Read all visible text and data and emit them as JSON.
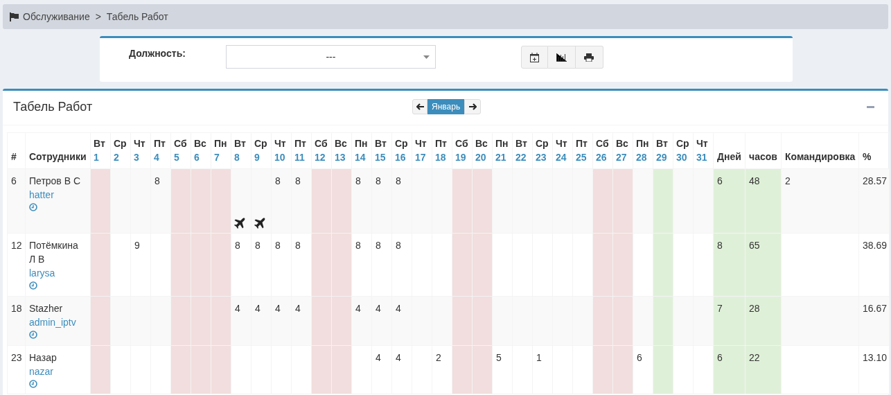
{
  "breadcrumb": {
    "items": [
      "Обслуживание",
      "Табель Работ"
    ],
    "separator": ">"
  },
  "filter": {
    "label": "Должность:",
    "select_value": "---"
  },
  "box": {
    "title": "Табель Работ",
    "month": "Январь"
  },
  "table": {
    "columns": {
      "id": "#",
      "employee": "Сотрудники",
      "days_total": "Дней",
      "hours_total": "часов",
      "trip": "Командировка",
      "percent": "%"
    },
    "days": [
      {
        "weekday": "Вт",
        "date": "1",
        "kind": "holiday"
      },
      {
        "weekday": "Ср",
        "date": "2",
        "kind": "normal"
      },
      {
        "weekday": "Чт",
        "date": "3",
        "kind": "normal"
      },
      {
        "weekday": "Пт",
        "date": "4",
        "kind": "normal"
      },
      {
        "weekday": "Сб",
        "date": "5",
        "kind": "holiday"
      },
      {
        "weekday": "Вс",
        "date": "6",
        "kind": "holiday"
      },
      {
        "weekday": "Пн",
        "date": "7",
        "kind": "holiday"
      },
      {
        "weekday": "Вт",
        "date": "8",
        "kind": "normal"
      },
      {
        "weekday": "Ср",
        "date": "9",
        "kind": "normal"
      },
      {
        "weekday": "Чт",
        "date": "10",
        "kind": "normal"
      },
      {
        "weekday": "Пт",
        "date": "11",
        "kind": "normal"
      },
      {
        "weekday": "Сб",
        "date": "12",
        "kind": "holiday"
      },
      {
        "weekday": "Вс",
        "date": "13",
        "kind": "holiday"
      },
      {
        "weekday": "Пн",
        "date": "14",
        "kind": "normal"
      },
      {
        "weekday": "Вт",
        "date": "15",
        "kind": "normal"
      },
      {
        "weekday": "Ср",
        "date": "16",
        "kind": "normal"
      },
      {
        "weekday": "Чт",
        "date": "17",
        "kind": "normal"
      },
      {
        "weekday": "Пт",
        "date": "18",
        "kind": "normal"
      },
      {
        "weekday": "Сб",
        "date": "19",
        "kind": "holiday"
      },
      {
        "weekday": "Вс",
        "date": "20",
        "kind": "holiday"
      },
      {
        "weekday": "Пн",
        "date": "21",
        "kind": "normal"
      },
      {
        "weekday": "Вт",
        "date": "22",
        "kind": "normal"
      },
      {
        "weekday": "Ср",
        "date": "23",
        "kind": "normal"
      },
      {
        "weekday": "Чт",
        "date": "24",
        "kind": "normal"
      },
      {
        "weekday": "Пт",
        "date": "25",
        "kind": "normal"
      },
      {
        "weekday": "Сб",
        "date": "26",
        "kind": "holiday"
      },
      {
        "weekday": "Вс",
        "date": "27",
        "kind": "holiday"
      },
      {
        "weekday": "Пн",
        "date": "28",
        "kind": "normal"
      },
      {
        "weekday": "Вт",
        "date": "29",
        "kind": "today"
      },
      {
        "weekday": "Ср",
        "date": "30",
        "kind": "normal"
      },
      {
        "weekday": "Чт",
        "date": "31",
        "kind": "normal"
      }
    ],
    "rows": [
      {
        "id": "6",
        "name": "Петров В С",
        "login": "hatter",
        "days_total": "6",
        "hours_total": "48",
        "trip": "2",
        "percent": "28.57",
        "cells": [
          {
            "trip": false
          },
          {
            "trip": false
          },
          {
            "trip": false
          },
          {
            "value": "8",
            "trip": false
          },
          {
            "trip": false
          },
          {
            "trip": false
          },
          {
            "trip": false
          },
          {
            "trip": true
          },
          {
            "trip": true
          },
          {
            "value": "8",
            "trip": false
          },
          {
            "value": "8",
            "trip": false
          },
          {
            "trip": false
          },
          {
            "trip": false
          },
          {
            "value": "8",
            "trip": false
          },
          {
            "value": "8",
            "trip": false
          },
          {
            "value": "8",
            "trip": false
          },
          {
            "trip": false
          },
          {
            "trip": false
          },
          {
            "trip": false
          },
          {
            "trip": false
          },
          {
            "trip": false
          },
          {
            "trip": false
          },
          {
            "trip": false
          },
          {
            "trip": false
          },
          {
            "trip": false
          },
          {
            "trip": false
          },
          {
            "trip": false
          },
          {
            "trip": false
          },
          {
            "trip": false
          },
          {
            "trip": false
          },
          {
            "trip": false
          }
        ]
      },
      {
        "id": "12",
        "name": "Потёмкина Л В",
        "login": "larysa",
        "days_total": "8",
        "hours_total": "65",
        "percent": "38.69",
        "cells": [
          {
            "trip": false
          },
          {
            "trip": false
          },
          {
            "value": "9",
            "trip": false
          },
          {
            "trip": false
          },
          {
            "trip": false
          },
          {
            "trip": false
          },
          {
            "trip": false
          },
          {
            "value": "8",
            "trip": false
          },
          {
            "value": "8",
            "trip": false
          },
          {
            "value": "8",
            "trip": false
          },
          {
            "value": "8",
            "trip": false
          },
          {
            "trip": false
          },
          {
            "trip": false
          },
          {
            "value": "8",
            "trip": false
          },
          {
            "value": "8",
            "trip": false
          },
          {
            "value": "8",
            "trip": false
          },
          {
            "trip": false
          },
          {
            "trip": false
          },
          {
            "trip": false
          },
          {
            "trip": false
          },
          {
            "trip": false
          },
          {
            "trip": false
          },
          {
            "trip": false
          },
          {
            "trip": false
          },
          {
            "trip": false
          },
          {
            "trip": false
          },
          {
            "trip": false
          },
          {
            "trip": false
          },
          {
            "trip": false
          },
          {
            "trip": false
          },
          {
            "trip": false
          }
        ]
      },
      {
        "id": "18",
        "name": "Stazher",
        "login": "admin_iptv",
        "days_total": "7",
        "hours_total": "28",
        "percent": "16.67",
        "cells": [
          {
            "trip": false
          },
          {
            "trip": false
          },
          {
            "trip": false
          },
          {
            "trip": false
          },
          {
            "trip": false
          },
          {
            "trip": false
          },
          {
            "trip": false
          },
          {
            "value": "4",
            "trip": false
          },
          {
            "value": "4",
            "trip": false
          },
          {
            "value": "4",
            "trip": false
          },
          {
            "value": "4",
            "trip": false
          },
          {
            "trip": false
          },
          {
            "trip": false
          },
          {
            "value": "4",
            "trip": false
          },
          {
            "value": "4",
            "trip": false
          },
          {
            "value": "4",
            "trip": false
          },
          {
            "trip": false
          },
          {
            "trip": false
          },
          {
            "trip": false
          },
          {
            "trip": false
          },
          {
            "trip": false
          },
          {
            "trip": false
          },
          {
            "trip": false
          },
          {
            "trip": false
          },
          {
            "trip": false
          },
          {
            "trip": false
          },
          {
            "trip": false
          },
          {
            "trip": false
          },
          {
            "trip": false
          },
          {
            "trip": false
          },
          {
            "trip": false
          }
        ]
      },
      {
        "id": "23",
        "name": "Назар",
        "login": "nazar",
        "days_total": "6",
        "hours_total": "22",
        "percent": "13.10",
        "cells": [
          {
            "trip": false
          },
          {
            "trip": false
          },
          {
            "trip": false
          },
          {
            "trip": false
          },
          {
            "trip": false
          },
          {
            "trip": false
          },
          {
            "trip": false
          },
          {
            "trip": false
          },
          {
            "trip": false
          },
          {
            "trip": false
          },
          {
            "trip": false
          },
          {
            "trip": false
          },
          {
            "trip": false
          },
          {
            "trip": false
          },
          {
            "value": "4",
            "trip": false
          },
          {
            "value": "4",
            "trip": false
          },
          {
            "trip": false
          },
          {
            "value": "2",
            "trip": false
          },
          {
            "trip": false
          },
          {
            "trip": false
          },
          {
            "value": "5",
            "trip": false
          },
          {
            "trip": false
          },
          {
            "value": "1",
            "trip": false
          },
          {
            "trip": false
          },
          {
            "trip": false
          },
          {
            "trip": false
          },
          {
            "trip": false
          },
          {
            "value": "6",
            "trip": false
          },
          {
            "trip": false
          },
          {
            "trip": false
          },
          {
            "trip": false
          }
        ]
      }
    ]
  }
}
